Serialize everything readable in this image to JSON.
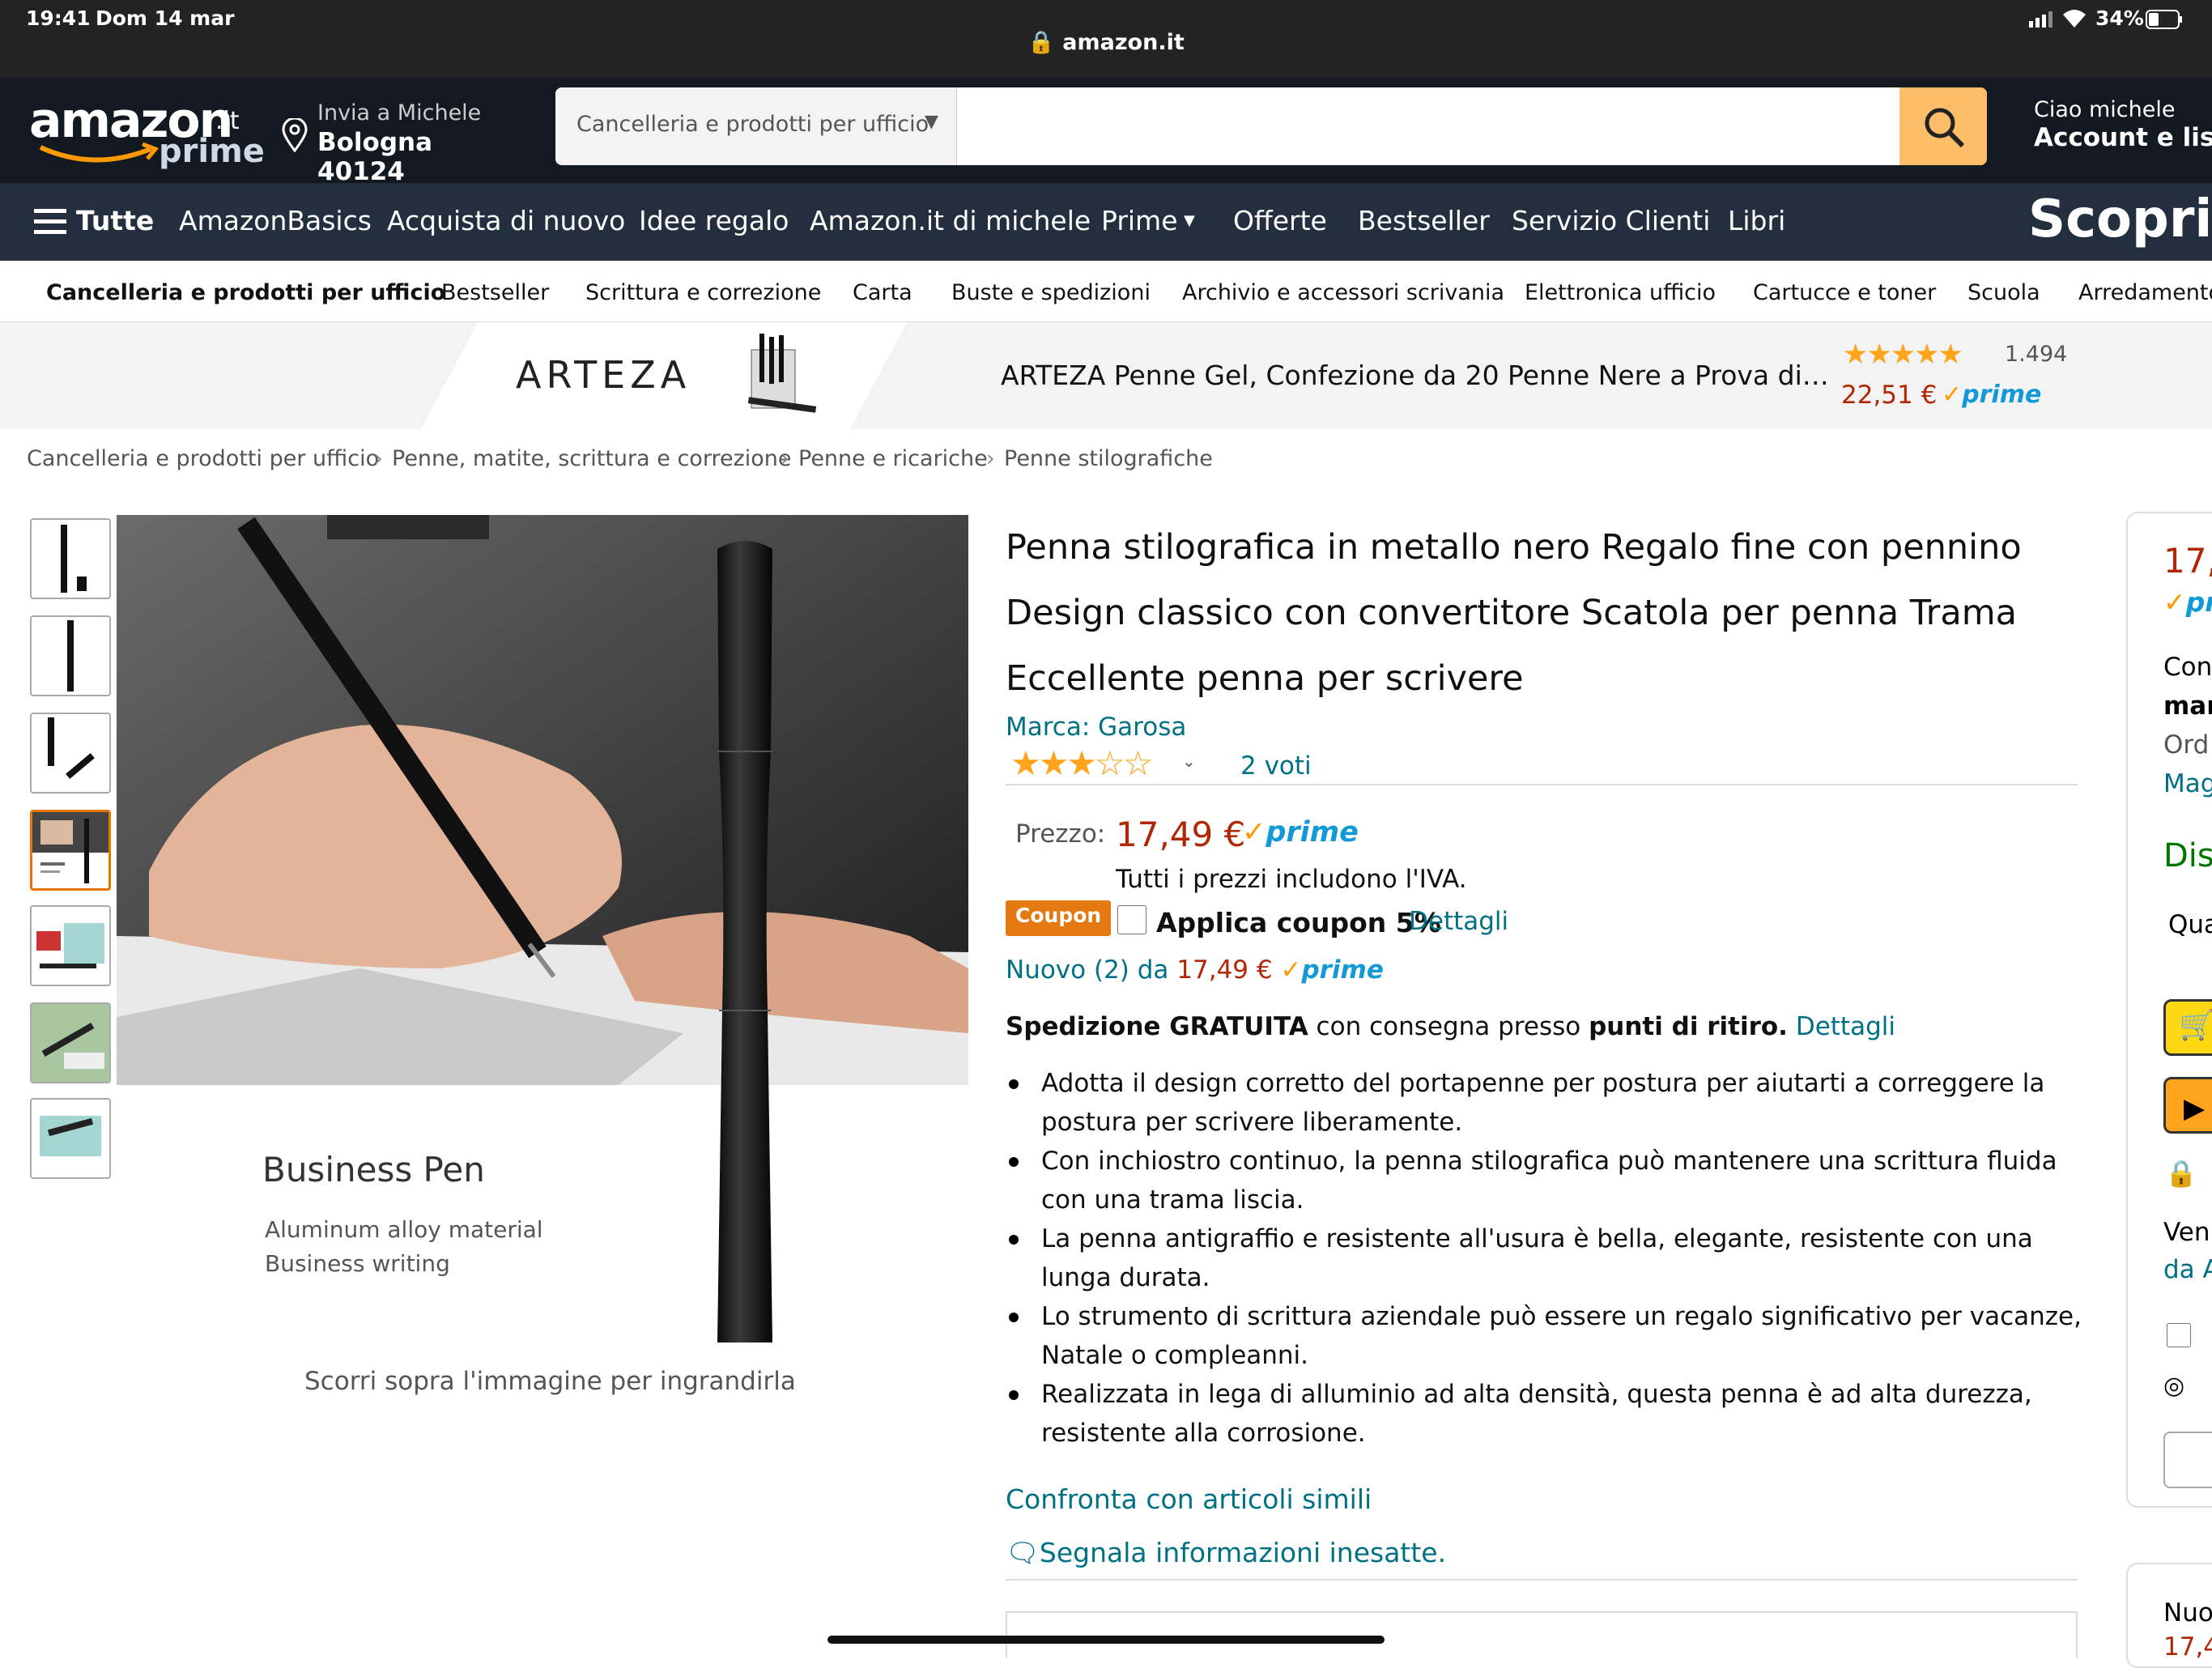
{
  "status": {
    "time": "19:41",
    "date": "Dom 14 mar",
    "battery": "34%",
    "url": "amazon.it"
  },
  "header": {
    "logo": "amazon",
    "logo_tld": ".it",
    "logo_prime": "prime",
    "deliver_line1": "Invia a Michele",
    "deliver_line2": "Bologna 40124",
    "search_category": "Cancelleria e prodotti per ufficio",
    "search_value": "",
    "greeting": "Ciao michele",
    "account": "Account e liste"
  },
  "nav": {
    "all": "Tutte",
    "items": [
      "AmazonBasics",
      "Acquista di nuovo",
      "Idee regalo",
      "Amazon.it di michele",
      "Prime",
      "Offerte",
      "Bestseller",
      "Servizio Clienti",
      "Libri"
    ],
    "promo": "Scopri t"
  },
  "subnav": [
    "Cancelleria e prodotti per ufficio",
    "Bestseller",
    "Scrittura e correzione",
    "Carta",
    "Buste e spedizioni",
    "Archivio e accessori scrivania",
    "Elettronica ufficio",
    "Cartucce e toner",
    "Scuola",
    "Arredamento"
  ],
  "ad": {
    "brand": "ARTEZA",
    "title": "ARTEZA Penne Gel, Confezione da 20 Penne Nere a Prova di…",
    "rating_count": "1.494",
    "price": "22,51 €",
    "prime": "prime",
    "rating": 4.5
  },
  "breadcrumb": [
    "Cancelleria e prodotti per ufficio",
    "Penne, matite, scrittura e correzione",
    "Penne e ricariche",
    "Penne stilografiche"
  ],
  "gallery": {
    "image_title": "Business Pen",
    "image_line1": "Aluminum alloy material",
    "image_line2": "Business writing",
    "hint": "Scorri sopra l'immagine per ingrandirla"
  },
  "product": {
    "title": "Penna stilografica in metallo nero Regalo fine con pennino Design classico con convertitore Scatola per penna Trama Eccellente penna per scrivere",
    "brand": "Marca: Garosa",
    "rating": 3,
    "votes": "2 voti",
    "price_label": "Prezzo:",
    "price": "17,49 €",
    "prime": "prime",
    "vat": "Tutti i prezzi includono l'IVA.",
    "coupon_badge": "Coupon",
    "coupon_text": "Applica coupon 5%",
    "details": "Dettagli",
    "new_offers": "Nuovo (2) da",
    "new_price": "17,49 €",
    "ship_bold1": "Spedizione GRATUITA",
    "ship_mid": " con consegna presso ",
    "ship_bold2": "punti di ritiro.",
    "bullets": [
      "Adotta il design corretto del portapenne per postura per aiutarti a correggere la postura per scrivere liberamente.",
      "Con inchiostro continuo, la penna stilografica può mantenere una scrittura fluida con una trama liscia.",
      "La penna antigraffio e resistente all'usura è bella, elegante, resistente con una lunga durata.",
      "Lo strumento di scrittura aziendale può essere un regalo significativo per vacanze, Natale o compleanni.",
      "Realizzata in lega di alluminio ad alta densità, questa penna è ad alta durezza, resistente alla corrosione."
    ],
    "compare": "Confronta con articoli simili",
    "report": "Segnala informazioni inesatte."
  },
  "buybox": {
    "price": "17,",
    "p": "pr",
    "l1": "Con",
    "l2": "man",
    "l3": "Ord",
    "l4": "Mag",
    "avail": "Dis",
    "qty": "Qua",
    "seller1": "Ven",
    "seller2": "da A",
    "new": "Nuo",
    "new_price": "17,4"
  }
}
